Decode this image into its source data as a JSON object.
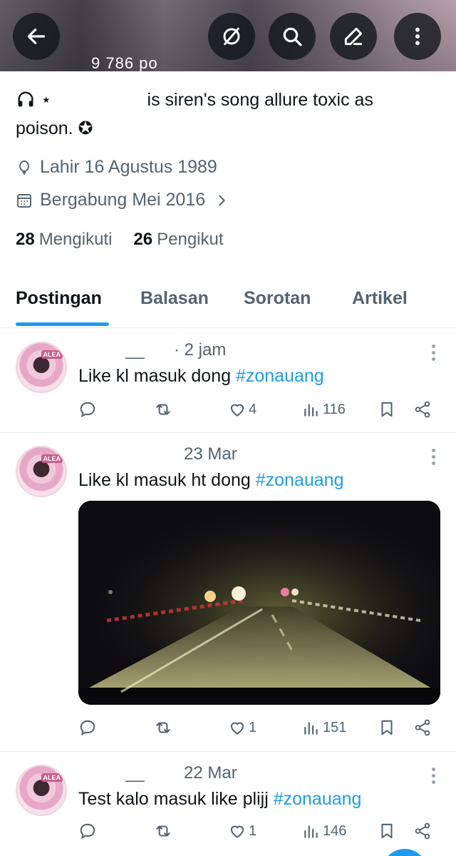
{
  "banner": {
    "count_text": "9 786 po"
  },
  "top_actions": [
    "back",
    "hide-icon",
    "search",
    "edit",
    "more"
  ],
  "profile": {
    "bio_prefix": "⋆",
    "bio_text": "is siren's song allure toxic as",
    "bio_line2": "poison. ✪",
    "birth": "Lahir 16 Agustus 1989",
    "joined": "Bergabung Mei 2016",
    "following_count": "28",
    "following_label": "Mengikuti",
    "followers_count": "26",
    "followers_label": "Pengikut"
  },
  "tabs": [
    "Postingan",
    "Balasan",
    "Sorotan",
    "Artikel"
  ],
  "active_tab": "Postingan",
  "colors": {
    "accent": "#1d9bf0",
    "text": "#0f1419",
    "muted": "#536471"
  },
  "posts": [
    {
      "name_fragment": "__",
      "time": "· 2 jam",
      "text_prefix": "Like kl masuk dong ",
      "hashtag": "#zonauang",
      "likes": "4",
      "views": "116",
      "avatar_tag": "ALEA"
    },
    {
      "name_fragment": "",
      "time": "23 Mar",
      "text_prefix": "Like kl masuk ht dong ",
      "hashtag": "#zonauang",
      "likes": "1",
      "views": "151",
      "avatar_tag": "ALEA",
      "has_media": true
    },
    {
      "name_fragment": "__",
      "time": "22 Mar",
      "text_prefix": "Test kalo masuk like plijj ",
      "hashtag": "#zonauang",
      "likes": "1",
      "views": "146",
      "avatar_tag": "ALEA"
    }
  ]
}
